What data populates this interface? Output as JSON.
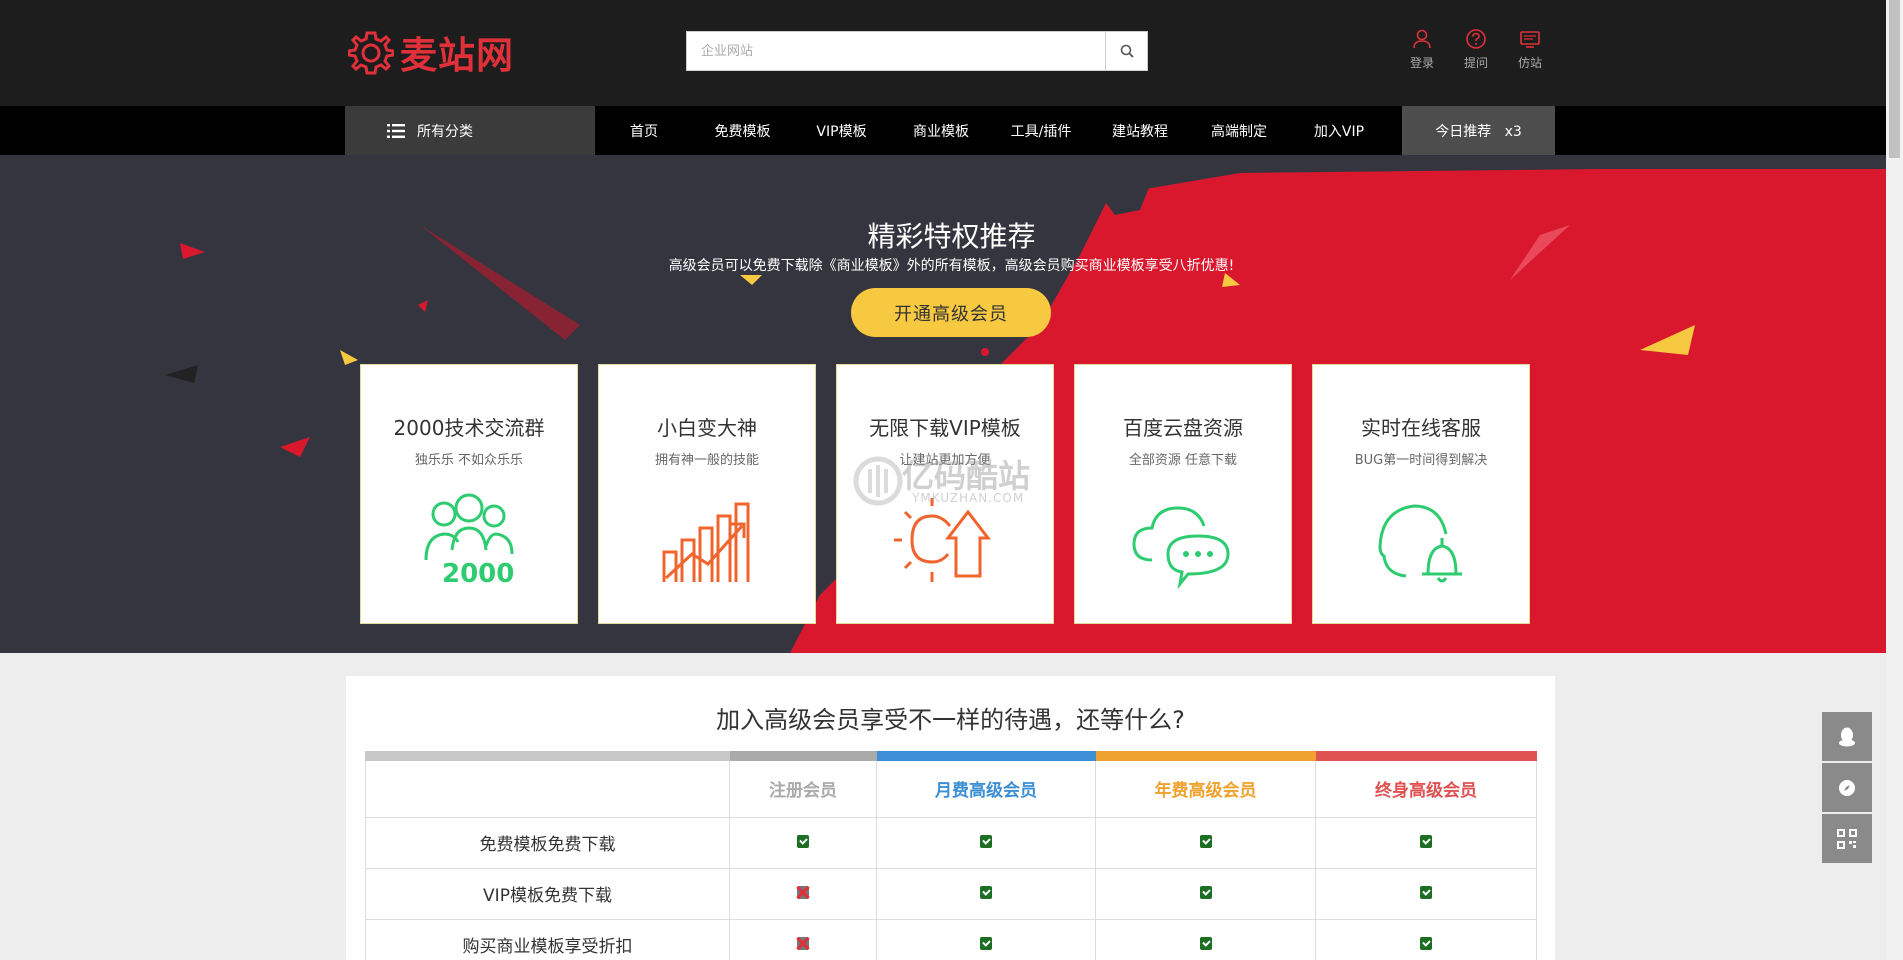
{
  "header": {
    "logo_text": "麦站网",
    "search": {
      "placeholder": "企业网站"
    },
    "tools": [
      {
        "label": "登录",
        "icon": "user-icon"
      },
      {
        "label": "提问",
        "icon": "question-icon"
      },
      {
        "label": "仿站",
        "icon": "monitor-icon"
      }
    ]
  },
  "nav": {
    "all_categories": "所有分类",
    "items": [
      "首页",
      "免费模板",
      "VIP模板",
      "商业模板",
      "工具/插件",
      "建站教程",
      "高端制定",
      "加入VIP"
    ],
    "today": "今日推荐   x3"
  },
  "hero": {
    "title": "精彩特权推荐",
    "subtitle": "高级会员可以免费下载除《商业模板》外的所有模板，高级会员购买商业模板享受八折优惠!",
    "cta": "开通高级会员",
    "cards": [
      {
        "title": "2000技术交流群",
        "sub": "独乐乐 不如众乐乐",
        "icon": "group-2000-icon"
      },
      {
        "title": "小白变大神",
        "sub": "拥有神一般的技能",
        "icon": "growth-chart-icon"
      },
      {
        "title": "无限下载VIP模板",
        "sub": "让建站更加方便",
        "icon": "sun-upload-icon"
      },
      {
        "title": "百度云盘资源",
        "sub": "全部资源 任意下载",
        "icon": "cloud-chat-icon"
      },
      {
        "title": "实时在线客服",
        "sub": "BUG第一时间得到解决",
        "icon": "support-bell-icon"
      }
    ]
  },
  "compare": {
    "title": "加入高级会员享受不一样的待遇，还等什么?",
    "columns": [
      {
        "label": "注册会员",
        "color": "#aaaaaa"
      },
      {
        "label": "月费高级会员",
        "color": "#3d8fd5"
      },
      {
        "label": "年费高级会员",
        "color": "#f0a22e"
      },
      {
        "label": "终身高级会员",
        "color": "#e05252"
      }
    ],
    "rows": [
      {
        "feature": "免费模板免费下载",
        "values": [
          true,
          true,
          true,
          true
        ]
      },
      {
        "feature": "VIP模板免费下载",
        "values": [
          false,
          true,
          true,
          true
        ]
      },
      {
        "feature": "购买商业模板享受折扣",
        "values": [
          false,
          true,
          true,
          true
        ]
      }
    ]
  },
  "watermark": {
    "text": "亿码酷站",
    "sub": "YMKUZHAN.COM"
  },
  "colors": {
    "brand_red": "#e0303a",
    "hero_dark": "#35353f",
    "hero_red": "#d9182e",
    "cta_yellow": "#f6c940"
  }
}
